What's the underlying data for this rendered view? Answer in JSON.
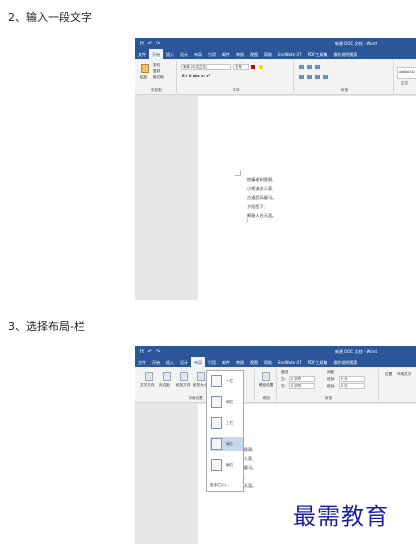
{
  "steps": [
    {
      "heading": "2、输入一段文字"
    },
    {
      "heading": "3、选择布局-栏"
    }
  ],
  "app": {
    "title": "新建 DOC 文档 - Word",
    "qat": [
      "H",
      "↶",
      "↷"
    ],
    "tabs": [
      "文件",
      "开始",
      "插入",
      "设计",
      "布局",
      "引用",
      "邮件",
      "审阅",
      "视图",
      "帮助",
      "EndNote X7",
      "PDF工具集",
      "操作说明搜索"
    ]
  },
  "home_ribbon": {
    "clipboard": {
      "group_label": "剪贴板",
      "paste": "粘贴",
      "cut": "剪切",
      "copy": "复制",
      "format_painter": "格式刷"
    },
    "font": {
      "group_label": "字体",
      "font_name": "宋体 (中文正文)",
      "font_size": "五号",
      "buttons": "B I U abc x₂ x²"
    },
    "paragraph": {
      "group_label": "段落"
    },
    "styles": {
      "style_preview": "AaBbCcD",
      "style_name": "正文"
    }
  },
  "layout_ribbon": {
    "page_setup": {
      "group_label": "页面设置",
      "buttons": [
        "文字方向",
        "页边距",
        "纸张方向",
        "纸张大小",
        "栏"
      ]
    },
    "breaks": {
      "breaks": "分隔符",
      "line_numbers": "行号",
      "hyphenation": "断字"
    },
    "manuscript": {
      "label": "稿纸设置",
      "group_label": "稿纸"
    },
    "indent": {
      "title": "缩进",
      "left_label": "左:",
      "left_value": "0 字符",
      "right_label": "右:",
      "right_value": "0 字符"
    },
    "spacing": {
      "title": "间距",
      "before_label": "段前:",
      "before_value": "0 行",
      "after_label": "段后:",
      "after_value": "0 行"
    },
    "group_label": "段落",
    "arrange": [
      "位置",
      "环绕文字"
    ]
  },
  "columns_menu": {
    "options": [
      "一栏",
      "两栏",
      "三栏",
      "偏左",
      "偏右"
    ],
    "more": "更多栏(C)..."
  },
  "document_lines": [
    "枯藤老树昏鸦,",
    "小桥流水人家,",
    "古道西风瘦马。",
    "夕阳西下,",
    "断肠人在天涯。"
  ],
  "watermark": "最需教育"
}
